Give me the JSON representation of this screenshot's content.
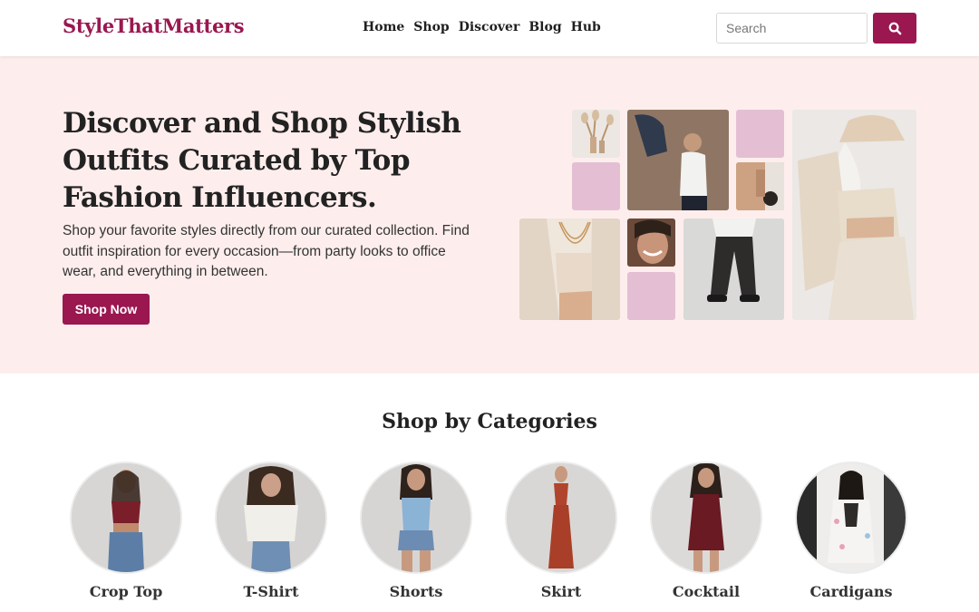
{
  "header": {
    "logo": "StyleThatMatters",
    "nav": [
      "Home",
      "Shop",
      "Discover",
      "Blog",
      "Hub"
    ],
    "search_placeholder": "Search",
    "search_icon": "search-icon"
  },
  "hero": {
    "title": "Discover and Shop Stylish Outfits Curated by Top Fashion Influencers.",
    "subtitle": "Shop your favorite styles directly from our curated collection. Find outfit inspiration for every occasion—from party looks to office wear, and everything in between.",
    "cta": "Shop Now"
  },
  "categories": {
    "title": "Shop by Categories",
    "items": [
      "Crop Top",
      "T-Shirt",
      "Shorts",
      "Skirt",
      "Cocktail",
      "Cardigans"
    ]
  },
  "colors": {
    "brand": "#9a1750",
    "hero_bg": "#fdeeed",
    "tile_pink": "#e4bfd3"
  }
}
